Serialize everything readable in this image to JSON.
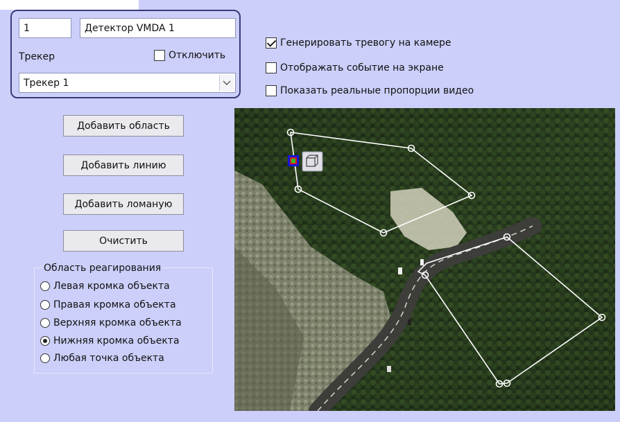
{
  "detector": {
    "id_value": "1",
    "name_value": "Детектор VMDA 1"
  },
  "tracker": {
    "label": "Трекер",
    "disable_label": "Отключить",
    "disable_checked": false,
    "selected": "Трекер 1"
  },
  "buttons": {
    "add_area": "Добавить область",
    "add_line": "Добавить линию",
    "add_polyline": "Добавить ломаную",
    "clear": "Очистить"
  },
  "reaction_area": {
    "title": "Область реагирования",
    "options": [
      {
        "label": "Левая кромка объекта",
        "checked": false
      },
      {
        "label": "Правая кромка объекта",
        "checked": false
      },
      {
        "label": "Верхняя кромка объекта",
        "checked": false
      },
      {
        "label": "Нижняя кромка объекта",
        "checked": true
      },
      {
        "label": "Любая точка объекта",
        "checked": false
      }
    ]
  },
  "options": {
    "generate_alarm": {
      "label": "Генерировать тревогу на камере",
      "checked": true
    },
    "show_event": {
      "label": "Отображать событие на экране",
      "checked": false
    },
    "real_proportions": {
      "label": "Показать реальные пропорции видео",
      "checked": false
    }
  },
  "icons": {
    "zone_color_handle": "color-square-icon",
    "zone_3d_handle": "cube-icon",
    "dropdown": "chevron-down-icon"
  },
  "colors": {
    "window_bg": "#cccff9",
    "panel_border": "#3a3a7a",
    "zone_line": "#ffffff"
  }
}
